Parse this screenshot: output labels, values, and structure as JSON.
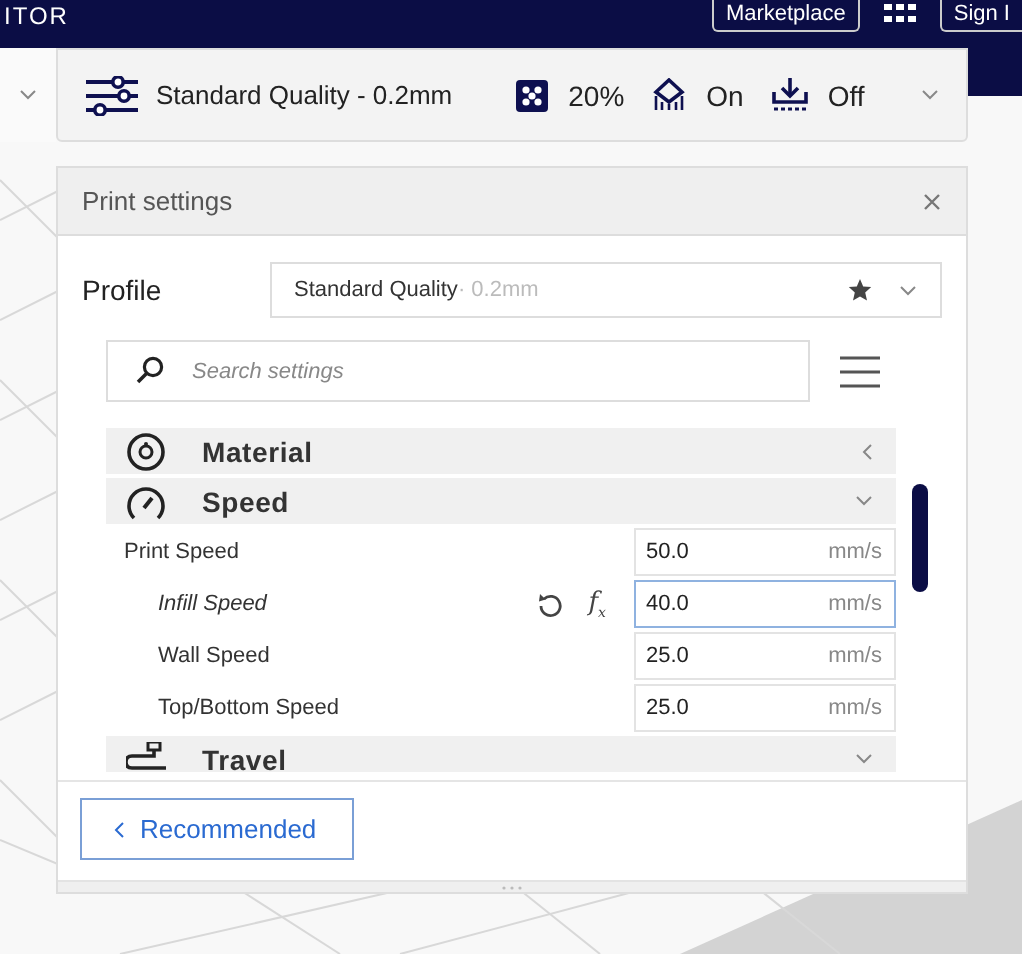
{
  "header": {
    "title": "ITOR",
    "marketplace": "Marketplace",
    "sign_in": "Sign I"
  },
  "print_bar": {
    "profile": "Standard Quality - 0.2mm",
    "infill": "20%",
    "support": "On",
    "adhesion": "Off"
  },
  "panel": {
    "title": "Print settings",
    "profile_label": "Profile",
    "profile_value": "Standard Quality",
    "profile_suffix": "· 0.2mm",
    "function_symbol": "f$_{x}$",
    "search": {
      "placeholder": "Search settings"
    },
    "categories": [
      {
        "kind": "material",
        "label": "Material",
        "expanded": false
      },
      {
        "kind": "speed",
        "label": "Speed",
        "expanded": true,
        "settings": [
          {
            "label": "Print Speed",
            "value": "50.0",
            "unit": "mm/s",
            "modified": false,
            "focused": false,
            "children": [
              {
                "label": "Infill Speed",
                "value": "40.0",
                "unit": "mm/s",
                "modified": true,
                "focused": true
              },
              {
                "label": "Wall Speed",
                "value": "25.0",
                "unit": "mm/s",
                "modified": false,
                "focused": false
              },
              {
                "label": "Top/Bottom Speed",
                "value": "25.0",
                "unit": "mm/s",
                "modified": false,
                "focused": false
              }
            ]
          }
        ]
      },
      {
        "kind": "travel",
        "label": "Travel",
        "expanded": true
      }
    ],
    "button": "Recommended"
  }
}
